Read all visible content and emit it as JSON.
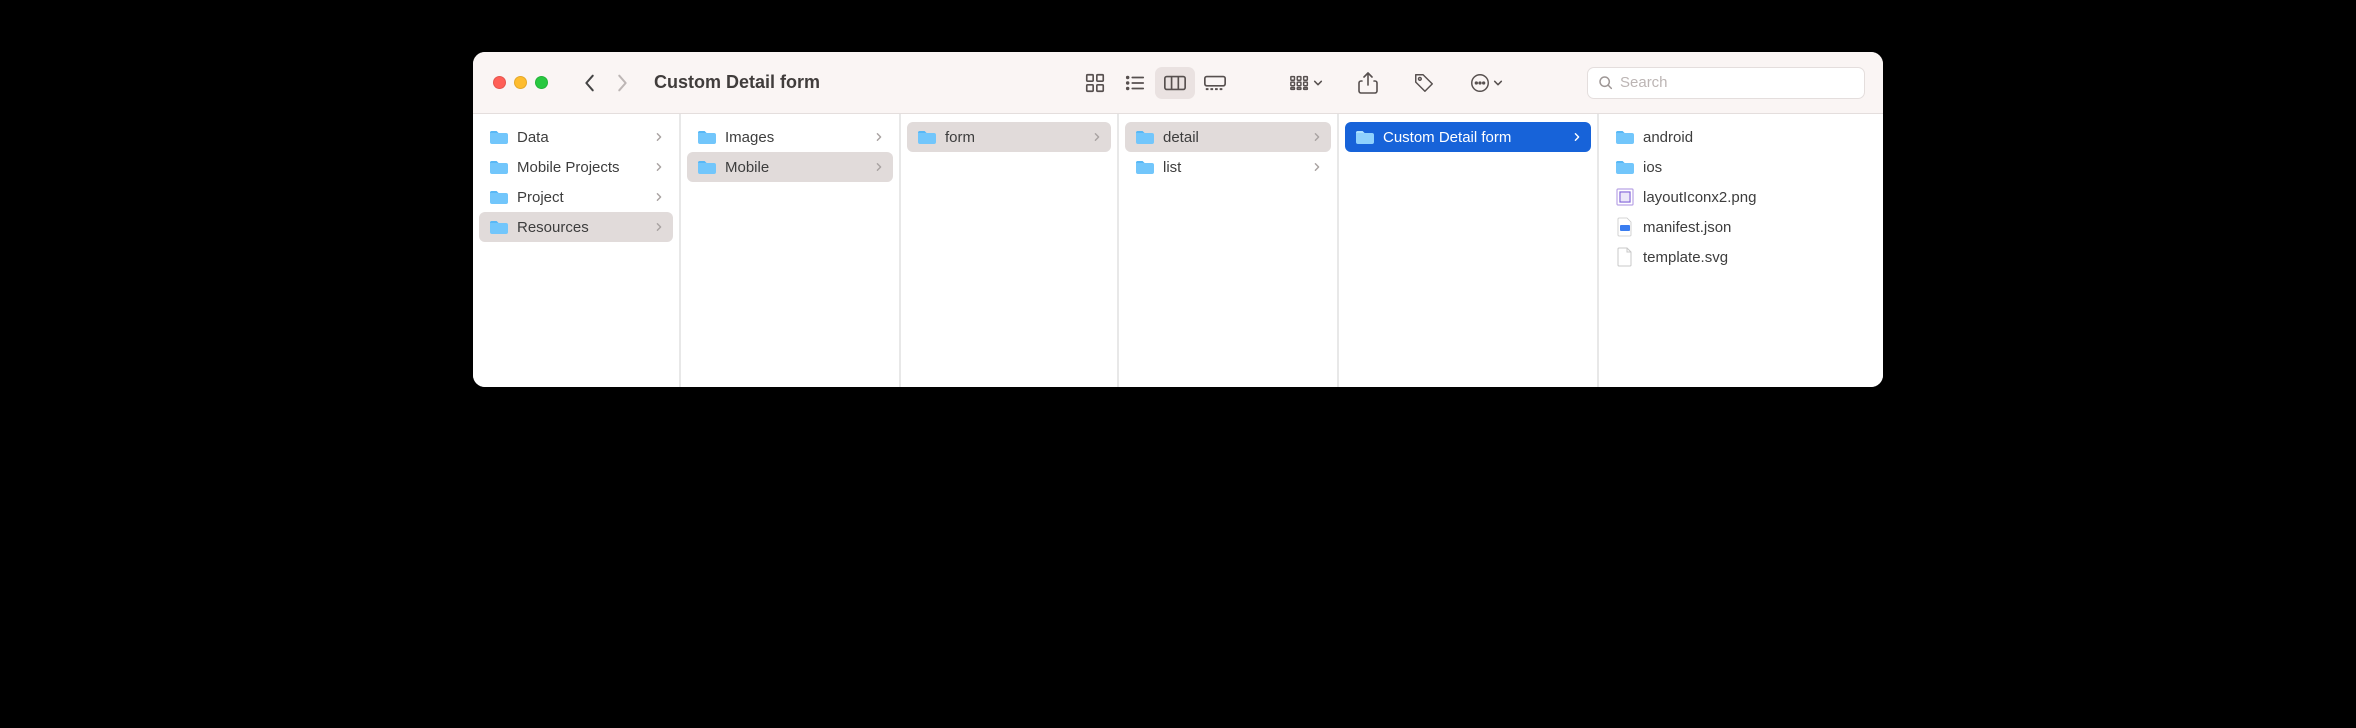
{
  "window": {
    "title": "Custom Detail form"
  },
  "search": {
    "placeholder": "Search",
    "value": ""
  },
  "columns": [
    {
      "items": [
        {
          "label": "Data",
          "icon": "folder",
          "selected": "none",
          "hasChildren": true
        },
        {
          "label": "Mobile Projects",
          "icon": "folder",
          "selected": "none",
          "hasChildren": true
        },
        {
          "label": "Project",
          "icon": "folder",
          "selected": "none",
          "hasChildren": true
        },
        {
          "label": "Resources",
          "icon": "folder",
          "selected": "path",
          "hasChildren": true
        }
      ]
    },
    {
      "items": [
        {
          "label": "Images",
          "icon": "folder",
          "selected": "none",
          "hasChildren": true
        },
        {
          "label": "Mobile",
          "icon": "folder",
          "selected": "path",
          "hasChildren": true
        }
      ]
    },
    {
      "items": [
        {
          "label": "form",
          "icon": "folder",
          "selected": "path",
          "hasChildren": true
        }
      ]
    },
    {
      "items": [
        {
          "label": "detail",
          "icon": "folder",
          "selected": "path",
          "hasChildren": true
        },
        {
          "label": "list",
          "icon": "folder",
          "selected": "none",
          "hasChildren": true
        }
      ]
    },
    {
      "items": [
        {
          "label": "Custom Detail form",
          "icon": "folder",
          "selected": "active",
          "hasChildren": true
        }
      ]
    },
    {
      "items": [
        {
          "label": "android",
          "icon": "folder",
          "selected": "none",
          "hasChildren": false
        },
        {
          "label": "ios",
          "icon": "folder",
          "selected": "none",
          "hasChildren": false
        },
        {
          "label": "layoutIconx2.png",
          "icon": "image",
          "selected": "none",
          "hasChildren": false
        },
        {
          "label": "manifest.json",
          "icon": "json",
          "selected": "none",
          "hasChildren": false
        },
        {
          "label": "template.svg",
          "icon": "file",
          "selected": "none",
          "hasChildren": false
        }
      ]
    }
  ]
}
